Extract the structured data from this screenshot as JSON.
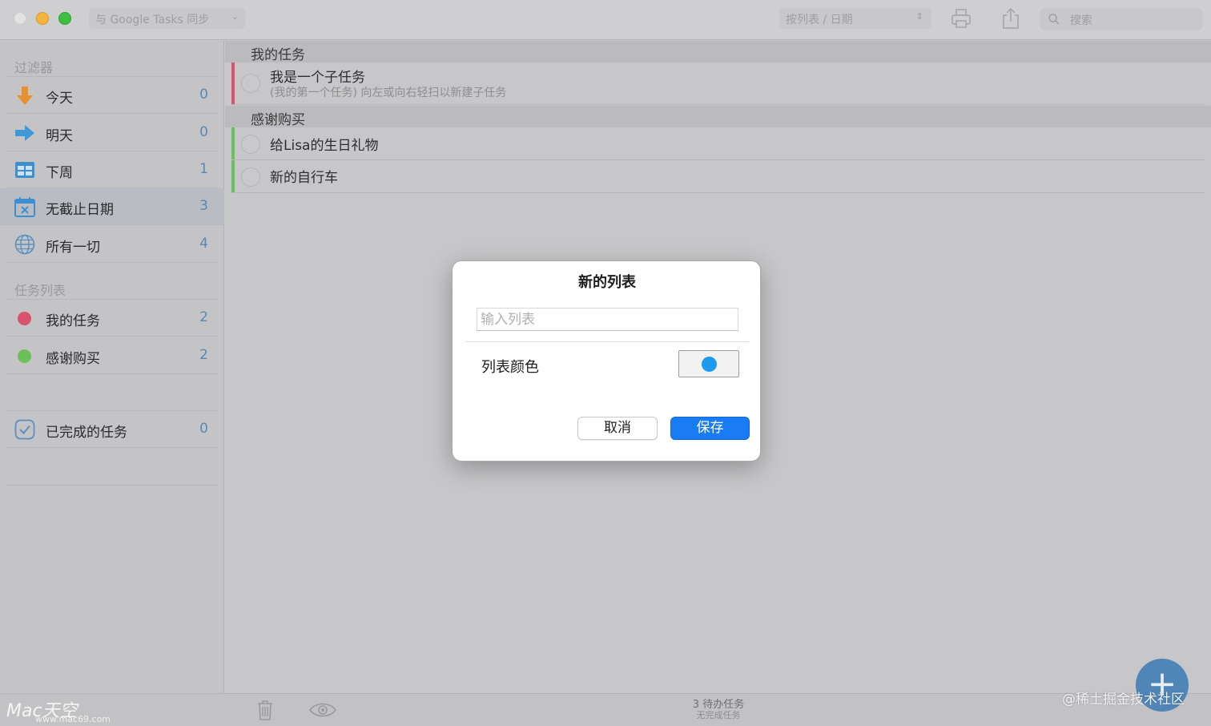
{
  "titlebar": {
    "sync_label": "与 Google Tasks 同步",
    "sort_label": "按列表 / 日期",
    "search_placeholder": "搜索"
  },
  "sidebar": {
    "filters_header": "过滤器",
    "filters": [
      {
        "label": "今天",
        "count": "0",
        "icon": "arrow-down-icon",
        "color": "#e8912f"
      },
      {
        "label": "明天",
        "count": "0",
        "icon": "arrow-right-icon",
        "color": "#3d9ad6"
      },
      {
        "label": "下周",
        "count": "1",
        "icon": "week-grid-icon",
        "color": "#3d8fd0"
      },
      {
        "label": "无截止日期",
        "count": "3",
        "icon": "calendar-x-icon",
        "color": "#3d8fd0"
      },
      {
        "label": "所有一切",
        "count": "4",
        "icon": "globe-icon",
        "color": "#5b8fc0"
      }
    ],
    "lists_header": "任务列表",
    "lists": [
      {
        "label": "我的任务",
        "count": "2",
        "color": "#d9536f"
      },
      {
        "label": "感谢购买",
        "count": "2",
        "color": "#6dbf5a"
      }
    ],
    "completed": {
      "label": "已完成的任务",
      "count": "0",
      "icon": "checkmark-icon"
    }
  },
  "main": {
    "groups": [
      {
        "name": "我的任务",
        "color": "#d9536f",
        "tasks": [
          {
            "title": "我是一个子任务",
            "subtitle": "(我的第一个任务) 向左或向右轻扫以新建子任务"
          }
        ]
      },
      {
        "name": "感谢购买",
        "color": "#6dbf5a",
        "tasks": [
          {
            "title": "给Lisa的生日礼物"
          },
          {
            "title": "新的自行车"
          }
        ]
      }
    ]
  },
  "bottombar": {
    "status_main": "3 待办任务",
    "status_sub": "无完成任务",
    "watermark": "@稀土掘金技术社区",
    "logo_text": "Mac天空",
    "logo_url": "www.mac69.com"
  },
  "dialog": {
    "title": "新的列表",
    "input_placeholder": "输入列表",
    "input_value": "",
    "color_label": "列表颜色",
    "selected_color": "#1d9bf0",
    "cancel_label": "取消",
    "save_label": "保存"
  }
}
